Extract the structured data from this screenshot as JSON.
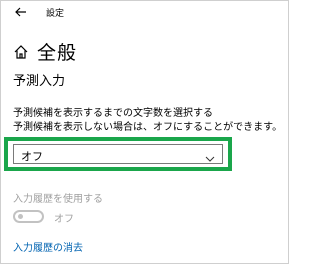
{
  "window": {
    "title": "設定"
  },
  "header": {
    "title": "全般"
  },
  "section": {
    "title": "予測入力"
  },
  "prediction": {
    "description_line1": "予測候補を表示するまでの文字数を選択する",
    "description_line2": "予測候補を表示しない場合は、オフにすることができます。",
    "dropdown_value": "オフ"
  },
  "history": {
    "toggle_label": "入力履歴を使用する",
    "toggle_state": "オフ",
    "toggle_on": false,
    "clear_link": "入力履歴の消去"
  },
  "colors": {
    "highlight": "#1aa64b",
    "link": "#0063b1",
    "disabled_text": "#a0a0a0"
  },
  "icons": [
    "back-arrow-icon",
    "home-icon",
    "chevron-down-icon"
  ]
}
